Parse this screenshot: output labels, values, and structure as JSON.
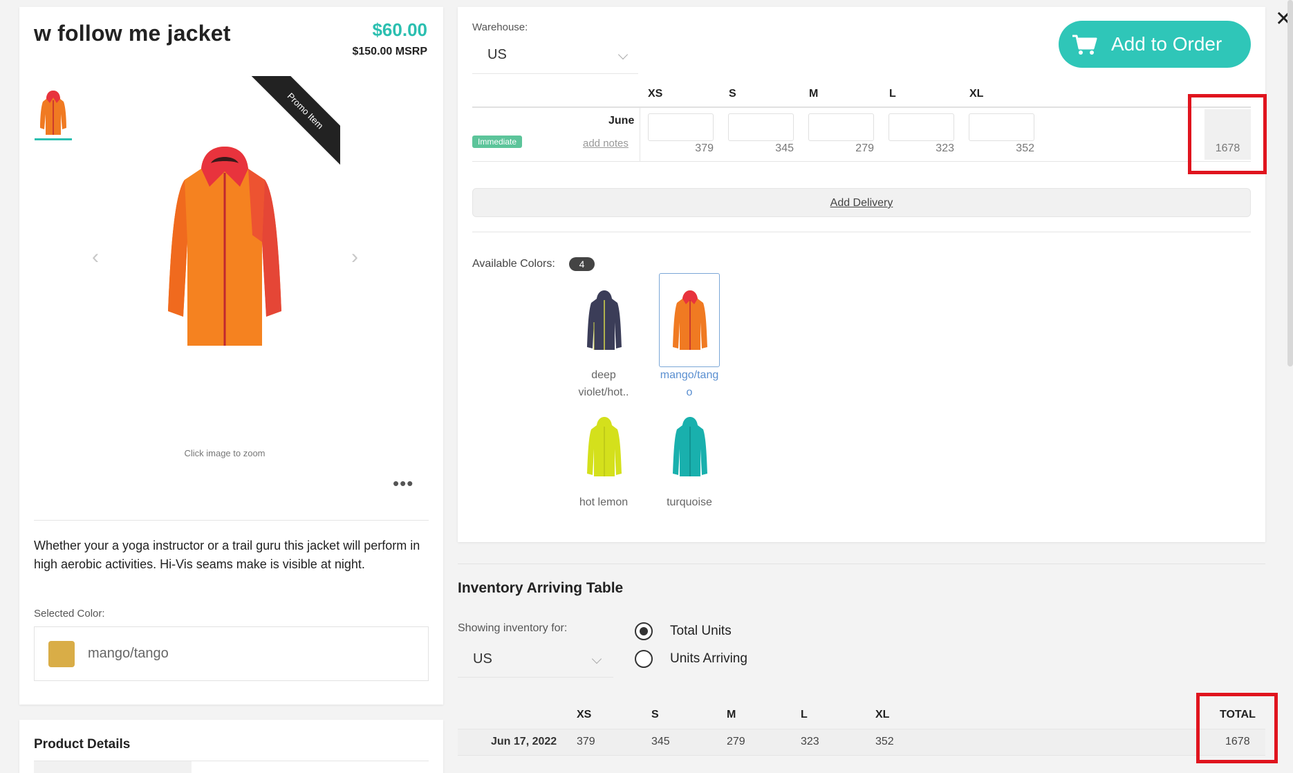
{
  "product": {
    "title": "w follow me jacket",
    "price": "$60.00",
    "msrp": "$150.00 MSRP",
    "promo_label": "Promo Item",
    "zoom_hint": "Click image to zoom",
    "more_icon": "•••",
    "description": "Whether your a yoga instructor or a trail guru this jacket will perform in high aerobic activities. Hi-Vis seams make is visible at night.",
    "selected_color_label": "Selected Color:",
    "selected_color_value": "mango/tango",
    "selected_color_swatch": "#d9ad47",
    "details_title": "Product Details"
  },
  "order": {
    "warehouse_label": "Warehouse:",
    "warehouse_value": "US",
    "add_button_label": "Add to Order",
    "sizes": [
      "XS",
      "S",
      "M",
      "L",
      "XL"
    ],
    "month": "June",
    "immediate_badge": "Immediate",
    "add_notes": "add notes",
    "available": [
      "379",
      "345",
      "279",
      "323",
      "352"
    ],
    "total": "1678",
    "add_delivery": "Add Delivery"
  },
  "colors": {
    "label": "Available Colors:",
    "count": "4",
    "items": [
      {
        "name_line1": "deep",
        "name_line2": "violet/hot..",
        "color": "#3b3d58",
        "accent": "#d6d64a"
      },
      {
        "name_line1": "mango/tang",
        "name_line2": "o",
        "color": "#f07a22",
        "accent": "#e8333d"
      },
      {
        "name_line1": "hot lemon",
        "name_line2": "",
        "color": "#d4e01c",
        "accent": "#b9c417"
      },
      {
        "name_line1": "turquoise",
        "name_line2": "",
        "color": "#19b0ad",
        "accent": "#0f8c8a"
      }
    ]
  },
  "inventory": {
    "title": "Inventory Arriving Table",
    "showing_label": "Showing inventory for:",
    "warehouse_value": "US",
    "radio_total": "Total Units",
    "radio_arriving": "Units Arriving",
    "headers": [
      "XS",
      "S",
      "M",
      "L",
      "XL"
    ],
    "total_header": "TOTAL",
    "date": "Jun 17, 2022",
    "values": [
      "379",
      "345",
      "279",
      "323",
      "352"
    ],
    "total": "1678"
  },
  "window": {
    "close_icon": "✕"
  },
  "theme": {
    "accent": "#2fc6b8",
    "highlight": "#e0141e"
  }
}
